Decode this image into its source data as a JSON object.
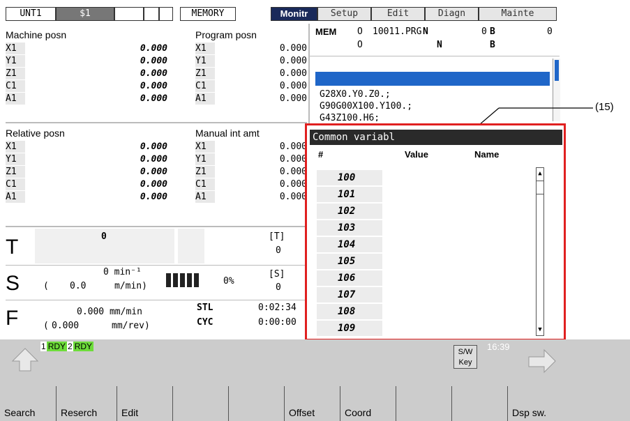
{
  "tabs": {
    "unt": "UNT1",
    "sys": "$1",
    "blank1": "",
    "blank2": "",
    "mode": "MEMORY",
    "monitr": "Monitr",
    "setup": "Setup",
    "edit": "Edit",
    "diagn": "Diagn",
    "mainte": "Mainte"
  },
  "machine_posn": {
    "title": "Machine posn",
    "axes": [
      {
        "name": "X1",
        "value": "0.000"
      },
      {
        "name": "Y1",
        "value": "0.000"
      },
      {
        "name": "Z1",
        "value": "0.000"
      },
      {
        "name": "C1",
        "value": "0.000"
      },
      {
        "name": "A1",
        "value": "0.000"
      }
    ]
  },
  "program_posn": {
    "title": "Program posn",
    "axes": [
      {
        "name": "X1",
        "value": "0.000"
      },
      {
        "name": "Y1",
        "value": "0.000"
      },
      {
        "name": "Z1",
        "value": "0.000"
      },
      {
        "name": "C1",
        "value": "0.000"
      },
      {
        "name": "A1",
        "value": "0.000"
      }
    ]
  },
  "relative_posn": {
    "title": "Relative posn",
    "axes": [
      {
        "name": "X1",
        "value": "0.000"
      },
      {
        "name": "Y1",
        "value": "0.000"
      },
      {
        "name": "Z1",
        "value": "0.000"
      },
      {
        "name": "C1",
        "value": "0.000"
      },
      {
        "name": "A1",
        "value": "0.000"
      }
    ]
  },
  "manual_int": {
    "title": "Manual int amt",
    "axes": [
      {
        "name": "X1",
        "value": "0.000"
      },
      {
        "name": "Y1",
        "value": "0.000"
      },
      {
        "name": "Z1",
        "value": "0.000"
      },
      {
        "name": "C1",
        "value": "0.000"
      },
      {
        "name": "A1",
        "value": "0.000"
      }
    ]
  },
  "program_status": {
    "mem": "MEM",
    "o_label": "O",
    "prog_no": "10011.PRG",
    "n_label": "N",
    "n_value": "0",
    "b_label": "B",
    "b_value": "0",
    "o_label2": "O",
    "n_label2": "N",
    "b_label2": "B"
  },
  "program_lines": [
    "G28X0.Y0.Z0.;",
    "G90G00X100.Y100.;",
    "G43Z100.H6;"
  ],
  "annotation": "(15)",
  "t_section": {
    "label": "T",
    "value": "0",
    "bracket": "[T]",
    "bracket_value": "0"
  },
  "s_section": {
    "label": "S",
    "speed": "0 min⁻¹",
    "paren_open": "(",
    "surface": "0.0",
    "surface_unit": "m/min)",
    "load_pct": "0%",
    "bracket": "[S]",
    "bracket_value": "0"
  },
  "f_section": {
    "label": "F",
    "feed": "0.000 mm/min",
    "paren_open": "(",
    "feed_rev": "0.000",
    "feed_rev_unit": "mm/rev)",
    "stl_label": "STL",
    "stl_time": "0:02:34",
    "cyc_label": "CYC",
    "cyc_time": "0:00:00"
  },
  "common_var": {
    "title": "Common variabl",
    "col_num": "#",
    "col_value": "Value",
    "col_name": "Name",
    "rows": [
      "100",
      "101",
      "102",
      "103",
      "104",
      "105",
      "106",
      "107",
      "108",
      "109"
    ]
  },
  "status_bar": {
    "rdy1_num": "1",
    "rdy1": "RDY",
    "rdy2_num": "2",
    "rdy2": "RDY",
    "sw_key": "S/W Key",
    "clock": "16:39"
  },
  "fkeys": [
    "Search",
    "Reserch",
    "Edit",
    "",
    "",
    "Offset",
    "Coord",
    "",
    "",
    "Dsp sw."
  ],
  "colors": {
    "active_tab": "#1a2a5a",
    "highlight": "#e02020",
    "program_bar": "#1f66c8",
    "rdy": "#6ddc3a"
  }
}
